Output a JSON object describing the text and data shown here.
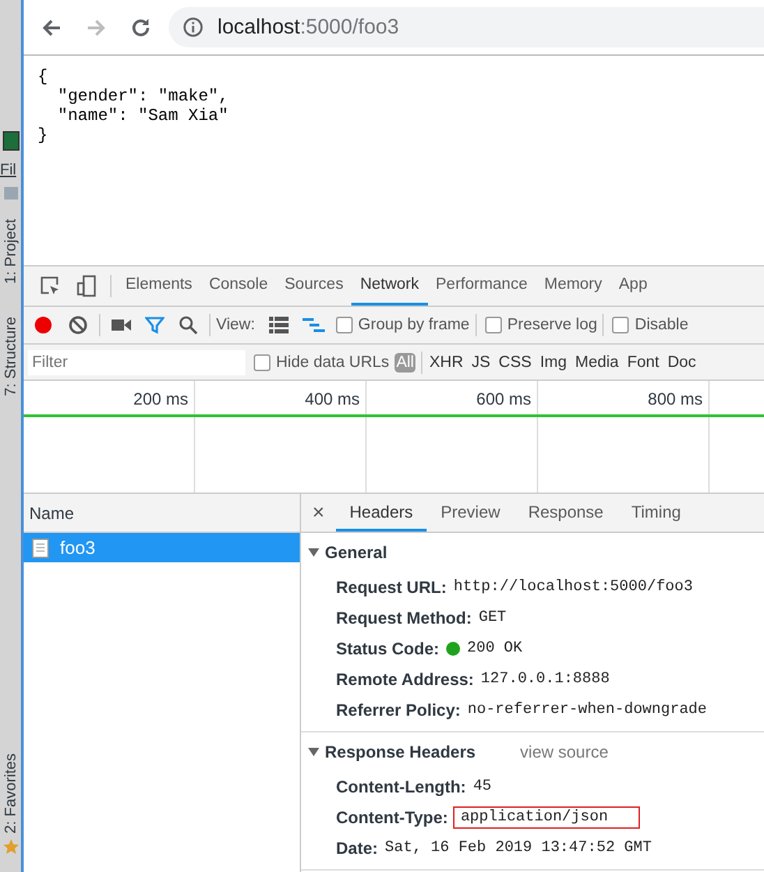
{
  "ide_strip": {
    "menu": "Fil",
    "tool_windows": [
      {
        "label": "1: Project"
      },
      {
        "label": "7: Structure"
      },
      {
        "label": "2: Favorites"
      }
    ]
  },
  "browser": {
    "nav": [
      {
        "kind": "back",
        "disabled": false
      },
      {
        "kind": "forward",
        "disabled": true
      },
      {
        "kind": "reload",
        "disabled": false
      }
    ],
    "url_host": "localhost",
    "url_rest": ":5000/foo3"
  },
  "page_lines": [
    "{",
    "  \"gender\": \"make\",",
    "  \"name\": \"Sam Xia\"",
    "}"
  ],
  "devtools": {
    "tabs": [
      {
        "label": "Elements",
        "selected": false
      },
      {
        "label": "Console",
        "selected": false
      },
      {
        "label": "Sources",
        "selected": false
      },
      {
        "label": "Network",
        "selected": true
      },
      {
        "label": "Performance",
        "selected": false
      },
      {
        "label": "Memory",
        "selected": false
      },
      {
        "label": "App",
        "selected": false
      }
    ],
    "toolbar": {
      "recording": true,
      "filter_active": true,
      "view_label": "View:",
      "waterfall_view": true,
      "checkboxes": [
        {
          "label": "Group by frame",
          "checked": false
        },
        {
          "label": "Preserve log",
          "checked": false
        },
        {
          "label": "Disable",
          "checked": false
        }
      ]
    },
    "filter": {
      "placeholder": "Filter",
      "hide_data_urls": {
        "label": "Hide data URLs",
        "checked": false
      },
      "types": [
        {
          "label": "All",
          "selected": true
        },
        {
          "label": "XHR",
          "selected": false
        },
        {
          "label": "JS",
          "selected": false
        },
        {
          "label": "CSS",
          "selected": false
        },
        {
          "label": "Img",
          "selected": false
        },
        {
          "label": "Media",
          "selected": false
        },
        {
          "label": "Font",
          "selected": false
        },
        {
          "label": "Doc",
          "selected": false
        }
      ]
    },
    "timeline": {
      "ticks": [
        "200 ms",
        "400 ms",
        "600 ms",
        "800 ms"
      ]
    },
    "requests": {
      "column": "Name",
      "rows": [
        {
          "name": "foo3",
          "selected": true
        }
      ]
    },
    "detail_tabs": [
      {
        "label": "Headers",
        "selected": true
      },
      {
        "label": "Preview",
        "selected": false
      },
      {
        "label": "Response",
        "selected": false
      },
      {
        "label": "Timing",
        "selected": false
      }
    ],
    "close_glyph": "×",
    "sections": [
      {
        "title": "General",
        "expanded": true,
        "rows": [
          {
            "key": "Request URL:",
            "value": "http://localhost:5000/foo3"
          },
          {
            "key": "Request Method:",
            "value": "GET"
          },
          {
            "key": "Status Code:",
            "value": "200 OK",
            "color": "#1fa31f"
          },
          {
            "key": "Remote Address:",
            "value": "127.0.0.1:8888"
          },
          {
            "key": "Referrer Policy:",
            "value": "no-referrer-when-downgrade"
          }
        ]
      },
      {
        "title": "Response Headers",
        "expanded": true,
        "link": "view source",
        "rows": [
          {
            "key": "Content-Length:",
            "value": "45"
          },
          {
            "key": "Content-Type:",
            "value": "application/json",
            "highlighted": true
          },
          {
            "key": "Date:",
            "value": "Sat, 16 Feb 2019 13:47:52 GMT"
          }
        ]
      }
    ]
  }
}
